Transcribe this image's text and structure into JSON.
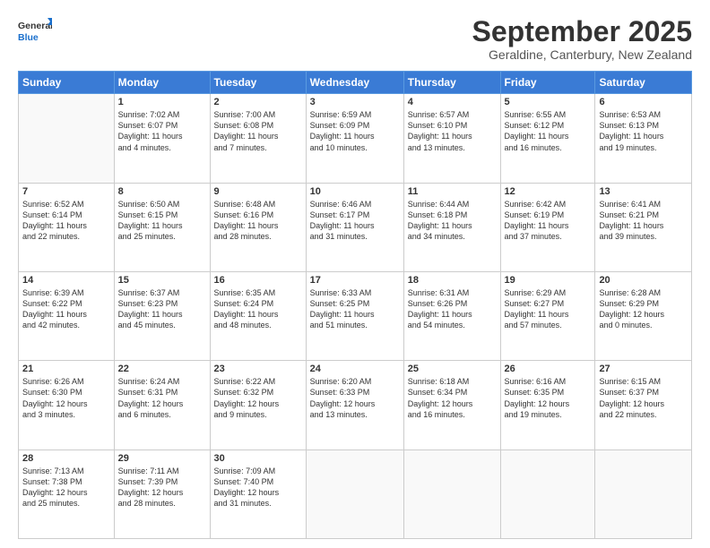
{
  "logo": {
    "general": "General",
    "blue": "Blue"
  },
  "title": "September 2025",
  "subtitle": "Geraldine, Canterbury, New Zealand",
  "days_of_week": [
    "Sunday",
    "Monday",
    "Tuesday",
    "Wednesday",
    "Thursday",
    "Friday",
    "Saturday"
  ],
  "weeks": [
    [
      {
        "day": "",
        "info": ""
      },
      {
        "day": "1",
        "info": "Sunrise: 7:02 AM\nSunset: 6:07 PM\nDaylight: 11 hours\nand 4 minutes."
      },
      {
        "day": "2",
        "info": "Sunrise: 7:00 AM\nSunset: 6:08 PM\nDaylight: 11 hours\nand 7 minutes."
      },
      {
        "day": "3",
        "info": "Sunrise: 6:59 AM\nSunset: 6:09 PM\nDaylight: 11 hours\nand 10 minutes."
      },
      {
        "day": "4",
        "info": "Sunrise: 6:57 AM\nSunset: 6:10 PM\nDaylight: 11 hours\nand 13 minutes."
      },
      {
        "day": "5",
        "info": "Sunrise: 6:55 AM\nSunset: 6:12 PM\nDaylight: 11 hours\nand 16 minutes."
      },
      {
        "day": "6",
        "info": "Sunrise: 6:53 AM\nSunset: 6:13 PM\nDaylight: 11 hours\nand 19 minutes."
      }
    ],
    [
      {
        "day": "7",
        "info": "Sunrise: 6:52 AM\nSunset: 6:14 PM\nDaylight: 11 hours\nand 22 minutes."
      },
      {
        "day": "8",
        "info": "Sunrise: 6:50 AM\nSunset: 6:15 PM\nDaylight: 11 hours\nand 25 minutes."
      },
      {
        "day": "9",
        "info": "Sunrise: 6:48 AM\nSunset: 6:16 PM\nDaylight: 11 hours\nand 28 minutes."
      },
      {
        "day": "10",
        "info": "Sunrise: 6:46 AM\nSunset: 6:17 PM\nDaylight: 11 hours\nand 31 minutes."
      },
      {
        "day": "11",
        "info": "Sunrise: 6:44 AM\nSunset: 6:18 PM\nDaylight: 11 hours\nand 34 minutes."
      },
      {
        "day": "12",
        "info": "Sunrise: 6:42 AM\nSunset: 6:19 PM\nDaylight: 11 hours\nand 37 minutes."
      },
      {
        "day": "13",
        "info": "Sunrise: 6:41 AM\nSunset: 6:21 PM\nDaylight: 11 hours\nand 39 minutes."
      }
    ],
    [
      {
        "day": "14",
        "info": "Sunrise: 6:39 AM\nSunset: 6:22 PM\nDaylight: 11 hours\nand 42 minutes."
      },
      {
        "day": "15",
        "info": "Sunrise: 6:37 AM\nSunset: 6:23 PM\nDaylight: 11 hours\nand 45 minutes."
      },
      {
        "day": "16",
        "info": "Sunrise: 6:35 AM\nSunset: 6:24 PM\nDaylight: 11 hours\nand 48 minutes."
      },
      {
        "day": "17",
        "info": "Sunrise: 6:33 AM\nSunset: 6:25 PM\nDaylight: 11 hours\nand 51 minutes."
      },
      {
        "day": "18",
        "info": "Sunrise: 6:31 AM\nSunset: 6:26 PM\nDaylight: 11 hours\nand 54 minutes."
      },
      {
        "day": "19",
        "info": "Sunrise: 6:29 AM\nSunset: 6:27 PM\nDaylight: 11 hours\nand 57 minutes."
      },
      {
        "day": "20",
        "info": "Sunrise: 6:28 AM\nSunset: 6:29 PM\nDaylight: 12 hours\nand 0 minutes."
      }
    ],
    [
      {
        "day": "21",
        "info": "Sunrise: 6:26 AM\nSunset: 6:30 PM\nDaylight: 12 hours\nand 3 minutes."
      },
      {
        "day": "22",
        "info": "Sunrise: 6:24 AM\nSunset: 6:31 PM\nDaylight: 12 hours\nand 6 minutes."
      },
      {
        "day": "23",
        "info": "Sunrise: 6:22 AM\nSunset: 6:32 PM\nDaylight: 12 hours\nand 9 minutes."
      },
      {
        "day": "24",
        "info": "Sunrise: 6:20 AM\nSunset: 6:33 PM\nDaylight: 12 hours\nand 13 minutes."
      },
      {
        "day": "25",
        "info": "Sunrise: 6:18 AM\nSunset: 6:34 PM\nDaylight: 12 hours\nand 16 minutes."
      },
      {
        "day": "26",
        "info": "Sunrise: 6:16 AM\nSunset: 6:35 PM\nDaylight: 12 hours\nand 19 minutes."
      },
      {
        "day": "27",
        "info": "Sunrise: 6:15 AM\nSunset: 6:37 PM\nDaylight: 12 hours\nand 22 minutes."
      }
    ],
    [
      {
        "day": "28",
        "info": "Sunrise: 7:13 AM\nSunset: 7:38 PM\nDaylight: 12 hours\nand 25 minutes."
      },
      {
        "day": "29",
        "info": "Sunrise: 7:11 AM\nSunset: 7:39 PM\nDaylight: 12 hours\nand 28 minutes."
      },
      {
        "day": "30",
        "info": "Sunrise: 7:09 AM\nSunset: 7:40 PM\nDaylight: 12 hours\nand 31 minutes."
      },
      {
        "day": "",
        "info": ""
      },
      {
        "day": "",
        "info": ""
      },
      {
        "day": "",
        "info": ""
      },
      {
        "day": "",
        "info": ""
      }
    ]
  ]
}
